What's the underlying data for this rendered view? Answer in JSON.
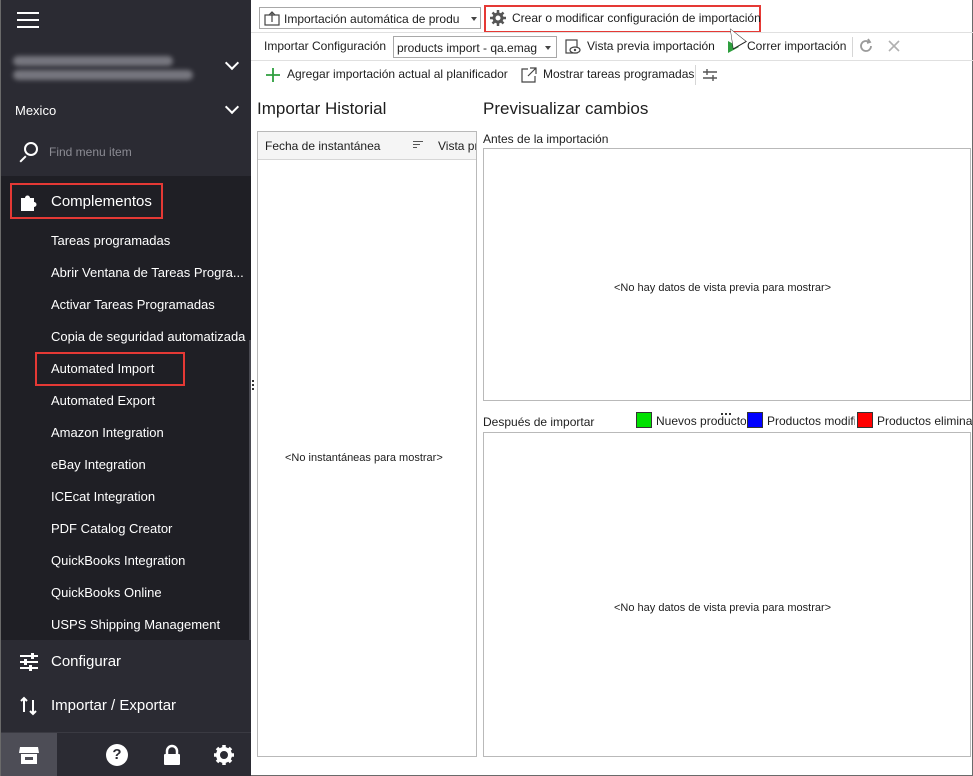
{
  "sidebar": {
    "store": "Mexico",
    "search": {
      "placeholder": "Find menu item"
    },
    "addons_section": "Complementos",
    "submenu": [
      "Tareas programadas",
      "Abrir Ventana de Tareas Progra...",
      "Activar Tareas Programadas",
      "Copia de seguridad automatizada",
      "Automated Import",
      "Automated Export",
      "Amazon Integration",
      "eBay Integration",
      "ICEcat Integration",
      "PDF Catalog Creator",
      "QuickBooks Integration",
      "QuickBooks Online",
      "USPS Shipping Management"
    ],
    "nav": {
      "configure": "Configurar",
      "import_export": "Importar / Exportar"
    },
    "bottom": {
      "help": "?"
    }
  },
  "toolbar": {
    "import_type_dropdown": "Importación automática de produ",
    "create_config_button": "Crear o modificar configuración de importación",
    "import_config_label": "Importar Configuración",
    "import_config_value": "products import - qa.emag",
    "preview_button": "Vista previa importación",
    "run_button": "Correr importación",
    "add_scheduler_button": "Agregar importación actual al planificador",
    "show_tasks_button": "Mostrar tareas programadas"
  },
  "history": {
    "title": "Importar Historial",
    "columns": [
      "Fecha de instantánea",
      "Vista previa"
    ],
    "empty": "<No instantáneas para mostrar>"
  },
  "preview": {
    "title": "Previsualizar cambios",
    "before_label": "Antes de la importación",
    "after_label": "Después de importar",
    "empty": "<No hay datos de vista previa para mostrar>",
    "legend": [
      {
        "label": "Nuevos productos",
        "color": "#00e000"
      },
      {
        "label": "Productos modificados",
        "color": "#0000ff"
      },
      {
        "label": "Productos eliminados",
        "color": "#ff0000"
      }
    ]
  },
  "colors": {
    "sidebar_bg": "#2b2b33",
    "submenu_bg": "#1f1f25",
    "highlight": "#e53935",
    "run_green": "#2e9e3e"
  }
}
